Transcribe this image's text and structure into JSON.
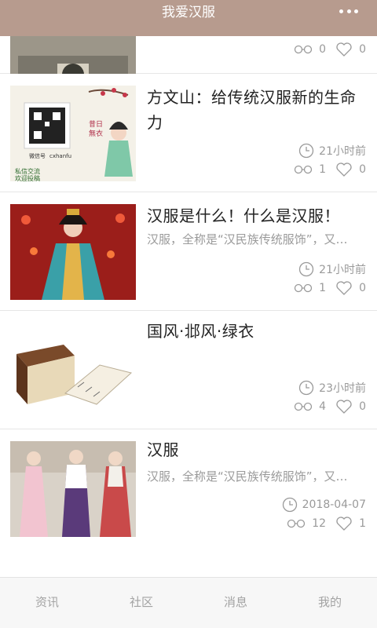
{
  "header": {
    "title": "我爱汉服",
    "more_icon": "more-icon"
  },
  "feed": [
    {
      "title": "",
      "summary": "",
      "time": "",
      "views": "0",
      "likes": "0"
    },
    {
      "title": "方文山：给传统汉服新的生命力",
      "summary": "",
      "time": "21小时前",
      "views": "1",
      "likes": "0",
      "image_text": {
        "wechat": "微信号",
        "id": "cxhanfu",
        "left": "私信交流 欢迎投稿",
        "right": "昔日無衣 与子同袍"
      }
    },
    {
      "title": "汉服是什么！什么是汉服！",
      "summary": "汉服，全称是“汉民族传统服饰”，又…",
      "time": "21小时前",
      "views": "1",
      "likes": "0"
    },
    {
      "title": "国风·邶风·绿衣",
      "summary": "",
      "time": "23小时前",
      "views": "4",
      "likes": "0"
    },
    {
      "title": "汉服",
      "summary": "汉服，全称是“汉民族传统服饰”，又…",
      "time": "2018-04-07",
      "views": "12",
      "likes": "1"
    }
  ],
  "tabbar": {
    "tabs": [
      {
        "label": "资讯"
      },
      {
        "label": "社区"
      },
      {
        "label": "消息"
      },
      {
        "label": "我的"
      }
    ]
  },
  "colors": {
    "header_bg": "#b79b8e",
    "text": "#222222",
    "muted": "#9a9a9a"
  }
}
